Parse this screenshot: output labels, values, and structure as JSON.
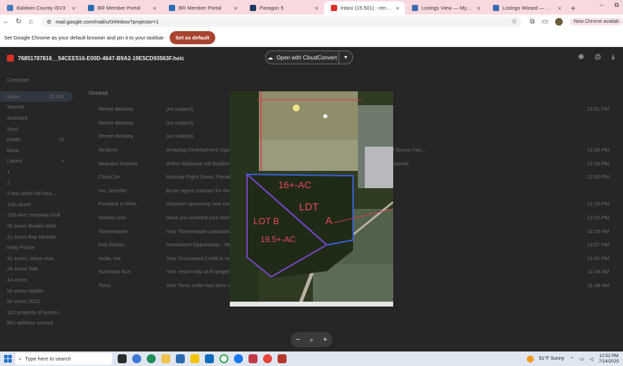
{
  "tabs": [
    {
      "label": "Baldwin County ISV3",
      "color": "#3f7fbf",
      "active": false
    },
    {
      "label": "BR Member Portal",
      "color": "#2b6cb0",
      "active": false
    },
    {
      "label": "BR Member Portal",
      "color": "#2b6cb0",
      "active": false
    },
    {
      "label": "Paragon 5",
      "color": "#1f3a5f",
      "active": false
    },
    {
      "label": "Inbox (15,501) - reneedonede",
      "color": "#d93025",
      "active": true
    },
    {
      "label": "Listings View — My State MLS",
      "color": "#3c6db4",
      "active": false
    },
    {
      "label": "Listings Wizard — My State MLS",
      "color": "#3c6db4",
      "active": false
    }
  ],
  "new_tab": "+",
  "window_controls": {
    "minimize": "–",
    "restore": "⧉"
  },
  "address": {
    "url": "mail.google.com/mail/u/0/#inbox?projector=1",
    "badge": "New Chrome availab"
  },
  "infobar": {
    "message": "Set Google Chrome as your default browser and pin it to your taskbar",
    "button": "Set as default"
  },
  "viewer": {
    "filename": "76851787816__54CEE516-E00D-4647-B9A2-19E5CD93563F.heic",
    "open_with": "Open with CloudConvert",
    "zoom_out": "−",
    "zoom_in": "+"
  },
  "photo_annotations": {
    "line1": "16+-AC",
    "line2": "LDT",
    "line3": "A",
    "left1": "LOT B",
    "left2": "19.5+-AC"
  },
  "gmail_sidebar": [
    {
      "label": "Compose",
      "count": ""
    },
    {
      "label": "Inbox",
      "count": "15,501"
    },
    {
      "label": "Starred",
      "count": ""
    },
    {
      "label": "Snoozed",
      "count": ""
    },
    {
      "label": "Sent",
      "count": ""
    },
    {
      "label": "Drafts",
      "count": "15"
    },
    {
      "label": "More",
      "count": ""
    },
    {
      "label": "Labels",
      "count": "+"
    },
    {
      "label": "1",
      "count": ""
    },
    {
      "label": "2",
      "count": ""
    },
    {
      "label": "2 lots white hill Rea...",
      "count": ""
    },
    {
      "label": "11th street",
      "count": ""
    },
    {
      "label": "11th Ave company Gulf",
      "count": ""
    },
    {
      "label": "20 acres Brooks Mall",
      "count": ""
    },
    {
      "label": "21 acres Bay Minette",
      "count": ""
    },
    {
      "label": "Holly Pointe",
      "count": ""
    },
    {
      "label": "31 acres, stove rese...",
      "count": ""
    },
    {
      "label": "34 acres Tide",
      "count": ""
    },
    {
      "label": "44 acres",
      "count": ""
    },
    {
      "label": "50 acres Mobile",
      "count": ""
    },
    {
      "label": "56 acres 2022",
      "count": ""
    },
    {
      "label": "101 property of summ...",
      "count": ""
    },
    {
      "label": "891 address council",
      "count": ""
    }
  ],
  "gmail_unread_header": "Unread",
  "gmail_rows": [
    {
      "sender": "Renee Beasley",
      "subject": "(no subject)",
      "date": "12:51 PM"
    },
    {
      "sender": "Renee Beasley",
      "subject": "(no subject)",
      "date": ""
    },
    {
      "sender": "Renee Beasley",
      "subject": "(no subject)",
      "date": ""
    },
    {
      "sender": "Realtors",
      "subject": "Amazing Development Opportunity - Baldwin County Broker Bulletin - Coastal Alabama Real Estate Bonus Fair...",
      "date": "12:38 PM"
    },
    {
      "sender": "Neandra Roberts",
      "subject": "Within Alabama Hill Builders in Baldwin County - last chance to sign up - Bayside Builders Annual Summit",
      "date": "12:33 PM"
    },
    {
      "sender": "ChirpCon",
      "subject": "Monday Flight Deals, Paradise - Holly Pointe weekend drive beach and escape offers",
      "date": "12:30 PM"
    },
    {
      "sender": "me, Jennifer",
      "subject": "Buyer agent contract for the property - Great Gulf coast listing review",
      "date": ""
    },
    {
      "sender": "Paradise in Pine..",
      "subject": "Discover upcoming new events near you",
      "date": "12:25 PM"
    },
    {
      "sender": "Homes.com",
      "subject": "Have you enlisted your listing agent - new listings nearby you may like",
      "date": "12:20 PM"
    },
    {
      "sender": "Ticketmaster",
      "subject": "Your Ticketmaster password changed - if this wasn't you, let us know",
      "date": "12:15 PM"
    },
    {
      "sender": "Eva Wilson",
      "subject": "Investment Opportunity - Re: Commercial listing for Baldwin County",
      "date": "12:07 PM"
    },
    {
      "sender": "Ivelia, me",
      "subject": "Your Crossword Credit is ready to redeem",
      "date": "12:00 PM"
    },
    {
      "sender": "Suncoast Sun",
      "subject": "Your resort stay at Evangeline Grand Hotel, Ascend Hotel Collection in Opelousas",
      "date": "11:54 AM"
    },
    {
      "sender": "Temu",
      "subject": "Your Temu order has been transferred to USPS for delivery",
      "date": "11:48 AM"
    }
  ],
  "taskbar": {
    "search_placeholder": "Type here to search",
    "weather": "91°F  Sunny",
    "time": "12:52 PM",
    "date": "7/14/2025"
  }
}
